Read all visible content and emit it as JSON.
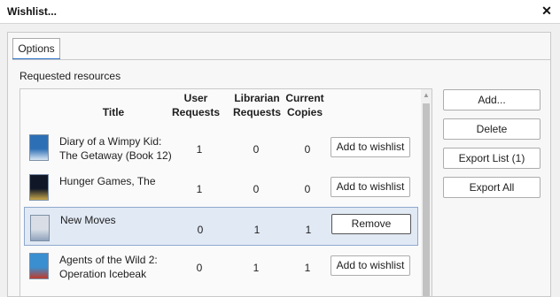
{
  "window": {
    "title": "Wishlist...",
    "close_glyph": "✕"
  },
  "tabs": [
    {
      "label": "Options"
    }
  ],
  "section_label": "Requested resources",
  "columns": {
    "title": "Title",
    "user_requests_1": "User",
    "user_requests_2": "Requests",
    "librarian_requests_1": "Librarian",
    "librarian_requests_2": "Requests",
    "current_copies_1": "Current",
    "current_copies_2": "Copies"
  },
  "rows": [
    {
      "title_line1": "Diary of a Wimpy Kid:",
      "title_line2": "The Getaway (Book 12)",
      "user_requests": "1",
      "librarian_requests": "0",
      "current_copies": "0",
      "action": "Add to wishlist",
      "selected": false,
      "cover_colors": [
        "#2d6fb5",
        "#d7e6f3"
      ]
    },
    {
      "title_line1": "Hunger Games, The",
      "title_line2": "",
      "user_requests": "1",
      "librarian_requests": "0",
      "current_copies": "0",
      "action": "Add to wishlist",
      "selected": false,
      "cover_colors": [
        "#101828",
        "#c9a84a"
      ]
    },
    {
      "title_line1": "New Moves",
      "title_line2": "",
      "user_requests": "0",
      "librarian_requests": "1",
      "current_copies": "1",
      "action": "Remove",
      "selected": true,
      "cover_colors": [
        "#d9dee6",
        "#8fa3bb"
      ]
    },
    {
      "title_line1": "Agents of the Wild 2:",
      "title_line2": "Operation Icebeak",
      "user_requests": "0",
      "librarian_requests": "1",
      "current_copies": "1",
      "action": "Add to wishlist",
      "selected": false,
      "cover_colors": [
        "#3a8fd0",
        "#c0392b"
      ]
    }
  ],
  "scrollbar": {
    "up_glyph": "▲"
  },
  "side_buttons": {
    "add": "Add...",
    "delete": "Delete",
    "export_list": "Export List (1)",
    "export_all": "Export All"
  }
}
